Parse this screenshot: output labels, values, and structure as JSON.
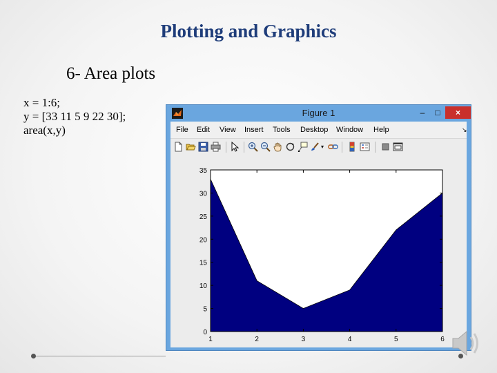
{
  "slide": {
    "title": "Plotting and Graphics",
    "heading": "6- Area plots",
    "code_lines": [
      "x = 1:6;",
      "y = [33 11 5 9 22 30];",
      "area(x,y)"
    ]
  },
  "figure_window": {
    "title": "Figure 1",
    "controls": {
      "minimize": "–",
      "maximize": "□",
      "close": "×"
    },
    "menu": [
      "File",
      "Edit",
      "View",
      "Insert",
      "Tools",
      "Desktop",
      "Window",
      "Help"
    ],
    "menu_overflow": "↘",
    "toolbar_icons": [
      "new-figure-icon",
      "open-file-icon",
      "save-icon",
      "print-icon",
      "edit-plot-icon",
      "zoom-in-icon",
      "zoom-out-icon",
      "pan-icon",
      "rotate-3d-icon",
      "data-cursor-icon",
      "brush-icon",
      "link-plot-icon",
      "insert-colorbar-icon",
      "insert-legend-icon",
      "hide-plot-tools-icon",
      "show-plot-tools-icon"
    ]
  },
  "colors": {
    "title": "#1f3d7a",
    "titlebar": "#6aa6df",
    "area_fill": "#000080",
    "close_button": "#c9302c"
  },
  "chart_data": {
    "type": "area",
    "x": [
      1,
      2,
      3,
      4,
      5,
      6
    ],
    "values": [
      33,
      11,
      5,
      9,
      22,
      30
    ],
    "xlim": [
      1,
      6
    ],
    "ylim": [
      0,
      35
    ],
    "xticks": [
      1,
      2,
      3,
      4,
      5,
      6
    ],
    "yticks": [
      0,
      5,
      10,
      15,
      20,
      25,
      30,
      35
    ],
    "title": "",
    "xlabel": "",
    "ylabel": "",
    "grid": false
  }
}
